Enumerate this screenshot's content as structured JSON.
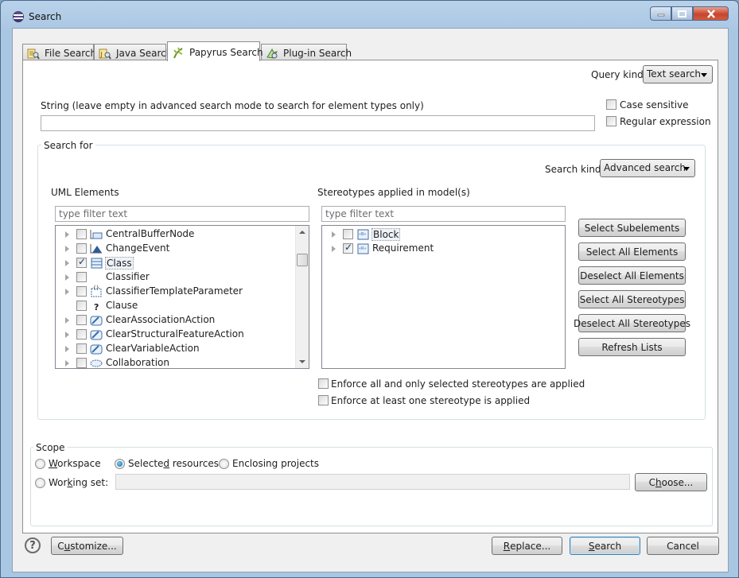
{
  "window": {
    "title": "Search"
  },
  "tabs": [
    {
      "label": "File Search",
      "icon": "file-search-icon"
    },
    {
      "label": "Java Search",
      "icon": "java-search-icon"
    },
    {
      "label": "Papyrus Search",
      "icon": "papyrus-search-icon",
      "active": true
    },
    {
      "label": "Plug-in Search",
      "icon": "plugin-search-icon"
    }
  ],
  "query": {
    "label": "Query kind:",
    "value": "Text search"
  },
  "string": {
    "label": "String (leave empty in advanced search mode to search for element types only)",
    "value": ""
  },
  "options": {
    "case_sensitive": {
      "label": "Case sensitive",
      "checked": false
    },
    "regex": {
      "label": "Regular expression",
      "checked": false
    }
  },
  "search_for": {
    "title": "Search for",
    "kind_label": "Search kind:",
    "kind_value": "Advanced search",
    "uml": {
      "title": "UML Elements",
      "filter_placeholder": "type filter text",
      "items": [
        {
          "label": "CentralBufferNode",
          "checked": false,
          "expandable": true,
          "icon": "central-buffer-node-icon"
        },
        {
          "label": "ChangeEvent",
          "checked": false,
          "expandable": true,
          "icon": "change-event-icon"
        },
        {
          "label": "Class",
          "checked": true,
          "expandable": true,
          "icon": "class-icon",
          "selected": true
        },
        {
          "label": "Classifier",
          "checked": false,
          "expandable": true,
          "icon": ""
        },
        {
          "label": "ClassifierTemplateParameter",
          "checked": false,
          "expandable": true,
          "icon": "classifier-template-parameter-icon"
        },
        {
          "label": "Clause",
          "checked": false,
          "expandable": false,
          "icon": "clause-icon"
        },
        {
          "label": "ClearAssociationAction",
          "checked": false,
          "expandable": true,
          "icon": "clear-association-action-icon"
        },
        {
          "label": "ClearStructuralFeatureAction",
          "checked": false,
          "expandable": true,
          "icon": "clear-structural-feature-action-icon"
        },
        {
          "label": "ClearVariableAction",
          "checked": false,
          "expandable": true,
          "icon": "clear-variable-action-icon"
        },
        {
          "label": "Collaboration",
          "checked": false,
          "expandable": true,
          "icon": "collaboration-icon"
        }
      ]
    },
    "stereotypes": {
      "title": "Stereotypes applied in model(s)",
      "filter_placeholder": "type filter text",
      "items": [
        {
          "label": "Block",
          "checked": false,
          "icon": "block-stereotype-icon",
          "selected": true
        },
        {
          "label": "Requirement",
          "checked": true,
          "icon": "requirement-stereotype-icon"
        }
      ]
    },
    "buttons": {
      "select_subelements": "Select Subelements",
      "select_all_elements": "Select All Elements",
      "deselect_all_elements": "Deselect All Elements",
      "select_all_stereotypes": "Select All Stereotypes",
      "deselect_all_stereotypes": "Deselect All Stereotypes",
      "refresh_lists": "Refresh Lists"
    },
    "enforce_all": {
      "label": "Enforce all and only selected stereotypes are applied",
      "checked": false
    },
    "enforce_one": {
      "label": "Enforce at least one stereotype is applied",
      "checked": false
    }
  },
  "scope": {
    "title": "Scope",
    "workspace": {
      "label_pre": "",
      "mnemonic": "W",
      "label_post": "orkspace",
      "selected": false
    },
    "selected_resources": {
      "label_pre": "Selecte",
      "mnemonic": "d",
      "label_post": " resources",
      "selected": true
    },
    "enclosing_projects": {
      "label_pre": "Enclosing pro",
      "mnemonic": "j",
      "label_post": "ects",
      "selected": false
    },
    "working_set": {
      "label_pre": "Wor",
      "mnemonic": "k",
      "label_post": "ing set:",
      "selected": false
    },
    "choose_button": {
      "label_pre": "C",
      "mnemonic": "h",
      "label_post": "oose..."
    }
  },
  "footer": {
    "customize_button": {
      "label_pre": "C",
      "mnemonic": "u",
      "label_post": "stomize..."
    },
    "replace_button": {
      "label_pre": "",
      "mnemonic": "R",
      "label_post": "eplace..."
    },
    "search_button": {
      "label_pre": "",
      "mnemonic": "S",
      "label_post": "earch"
    },
    "cancel_button": "Cancel"
  }
}
